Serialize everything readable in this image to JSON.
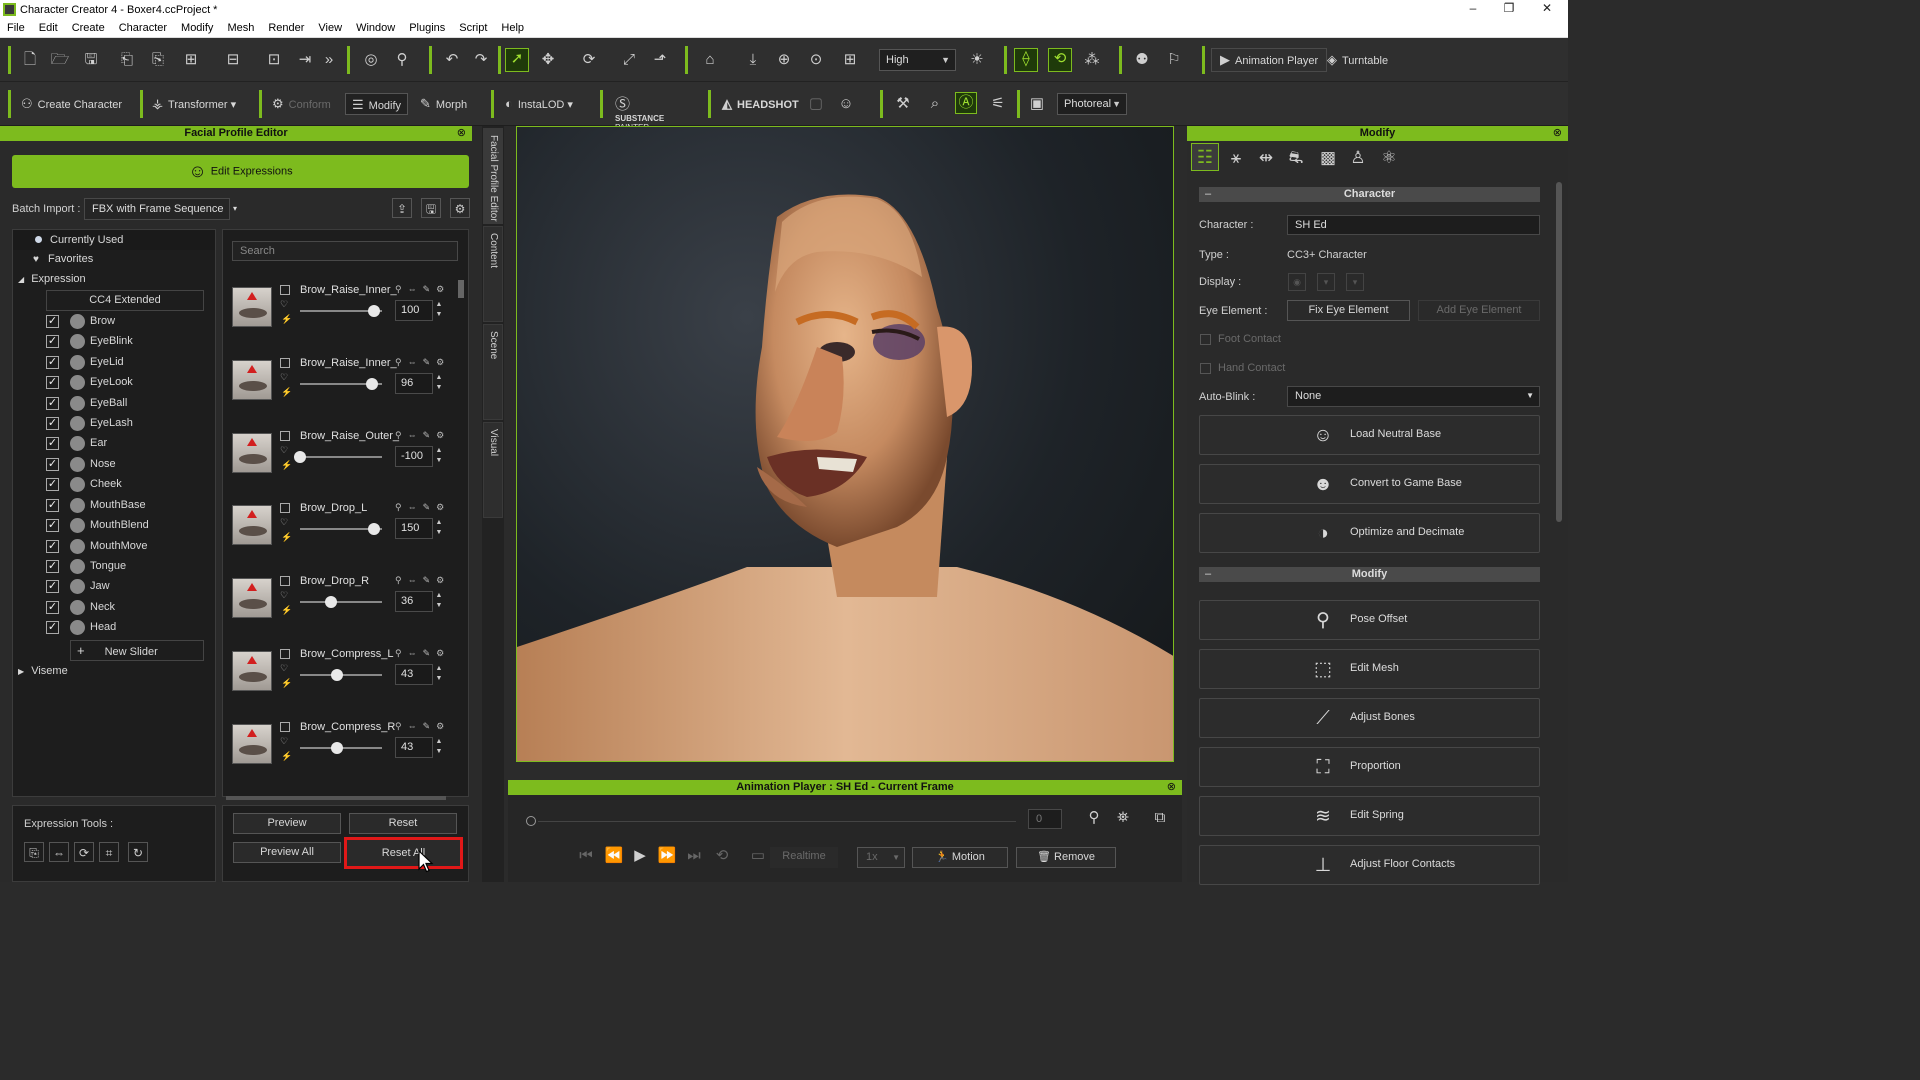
{
  "titlebar": {
    "title": "Character Creator 4 - Boxer4.ccProject *",
    "min": "–",
    "max": "❐",
    "close": "✕"
  },
  "menu": [
    "File",
    "Edit",
    "Create",
    "Character",
    "Modify",
    "Mesh",
    "Render",
    "View",
    "Window",
    "Plugins",
    "Script",
    "Help"
  ],
  "toolbar1": {
    "quality": "High",
    "animation_player": "Animation Player",
    "turntable": "Turntable"
  },
  "toolbar2": {
    "create_character": "Create Character",
    "transformer": "Transformer",
    "conform": "Conform",
    "modify": "Modify",
    "morph": "Morph",
    "instalod": "InstaLOD",
    "substance_line1": "SUBSTANCE",
    "substance_line2": "PAINTER",
    "headshot": "HEADSHOT",
    "render_mode": "Photoreal"
  },
  "left_panel": {
    "title": "Facial Profile Editor",
    "close": "⊗",
    "edit_expressions": "Edit Expressions",
    "batch_import_label": "Batch Import :",
    "batch_import_value": "FBX with Frame Sequence",
    "search_placeholder": "Search",
    "tree": {
      "currently_used": "Currently Used",
      "favorites": "Favorites",
      "expression": "Expression",
      "cc4_extended": "CC4 Extended",
      "categories": [
        "Brow",
        "EyeBlink",
        "EyeLid",
        "EyeLook",
        "EyeBall",
        "EyeLash",
        "Ear",
        "Nose",
        "Cheek",
        "MouthBase",
        "MouthBlend",
        "MouthMove",
        "Tongue",
        "Jaw",
        "Neck",
        "Head"
      ],
      "new_slider": "New Slider",
      "viseme": "Viseme"
    },
    "morphs": [
      {
        "name": "Brow_Raise_Inner_",
        "value": "100"
      },
      {
        "name": "Brow_Raise_Inner_",
        "value": "96"
      },
      {
        "name": "Brow_Raise_Outer_",
        "value": "-100"
      },
      {
        "name": "Brow_Drop_L",
        "value": "150"
      },
      {
        "name": "Brow_Drop_R",
        "value": "36"
      },
      {
        "name": "Brow_Compress_L",
        "value": "43"
      },
      {
        "name": "Brow_Compress_R",
        "value": "43"
      }
    ],
    "slider_levels": [
      0.9,
      0.88,
      0.0,
      0.9,
      0.38,
      0.45,
      0.45
    ],
    "expression_tools_label": "Expression Tools :",
    "preview": "Preview",
    "reset": "Reset",
    "preview_all": "Preview All",
    "reset_all": "Reset All"
  },
  "side_tabs": [
    "Facial Profile Editor",
    "Content",
    "Scene",
    "Visual"
  ],
  "animation_player": {
    "title": "Animation Player : SH Ed - Current Frame",
    "frame": "0",
    "realtime": "Realtime",
    "speed": "1x",
    "motion": "Motion",
    "remove": "Remove"
  },
  "right_panel": {
    "title": "Modify",
    "character_section": "Character",
    "character_label": "Character :",
    "character_value": "SH Ed",
    "type_label": "Type :",
    "type_value": "CC3+ Character",
    "display_label": "Display :",
    "eye_element_label": "Eye Element :",
    "fix_eye_element": "Fix Eye Element",
    "add_eye_element": "Add Eye Element",
    "foot_contact": "Foot Contact",
    "hand_contact": "Hand Contact",
    "auto_blink_label": "Auto-Blink :",
    "auto_blink_value": "None",
    "load_neutral_base": "Load Neutral Base",
    "convert_game_base": "Convert to Game Base",
    "optimize_decimate": "Optimize and Decimate",
    "modify_section": "Modify",
    "pose_offset": "Pose Offset",
    "edit_mesh": "Edit Mesh",
    "adjust_bones": "Adjust Bones",
    "proportion": "Proportion",
    "edit_spring": "Edit Spring",
    "adjust_floor_contacts": "Adjust Floor Contacts"
  },
  "colors": {
    "accent": "#7dbb1e",
    "highlight_red": "#e01818"
  }
}
